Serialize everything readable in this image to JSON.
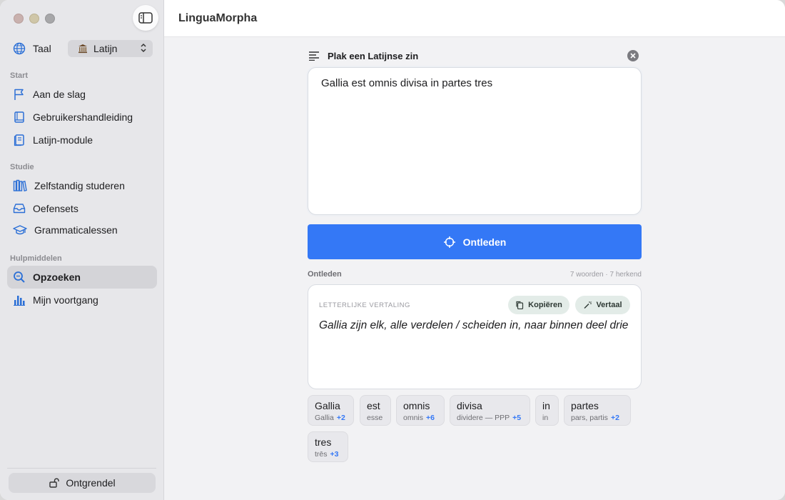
{
  "app": {
    "title": "LinguaMorpha"
  },
  "sidebar": {
    "language": {
      "label": "Taal",
      "selected": "Latijn"
    },
    "sections": [
      {
        "label": "Start",
        "items": [
          {
            "label": "Aan de slag",
            "icon": "flag-icon"
          },
          {
            "label": "Gebruikershandleiding",
            "icon": "book-icon"
          },
          {
            "label": "Latijn-module",
            "icon": "document-icon"
          }
        ]
      },
      {
        "label": "Studie",
        "items": [
          {
            "label": "Zelfstandig studeren",
            "icon": "library-icon"
          },
          {
            "label": "Oefensets",
            "icon": "tray-icon"
          },
          {
            "label": "Grammaticalessen",
            "icon": "graduation-cap-icon"
          }
        ]
      },
      {
        "label": "Hulpmiddelen",
        "items": [
          {
            "label": "Opzoeken",
            "icon": "search-icon",
            "active": true
          },
          {
            "label": "Mijn voortgang",
            "icon": "bar-chart-icon"
          }
        ]
      }
    ],
    "unlock_label": "Ontgrendel"
  },
  "input": {
    "header": "Plak een Latijnse zin",
    "text": "Gallia est omnis divisa in partes tres"
  },
  "parse_button": "Ontleden",
  "result": {
    "title": "Ontleden",
    "stats": "7 woorden · 7 herkend",
    "translation_label": "LETTERLIJKE VERTALING",
    "copy_label": "Kopiëren",
    "translate_label": "Vertaal",
    "translation": "Gallia zijn elk, alle verdelen / scheiden in, naar binnen deel drie"
  },
  "tokens": [
    {
      "word": "Gallia",
      "lemma": "Gallia",
      "more": "+2"
    },
    {
      "word": "est",
      "lemma": "esse",
      "more": ""
    },
    {
      "word": "omnis",
      "lemma": "omnis",
      "more": "+6"
    },
    {
      "word": "divisa",
      "lemma": "dividere — PPP",
      "more": "+5"
    },
    {
      "word": "in",
      "lemma": "in",
      "more": ""
    },
    {
      "word": "partes",
      "lemma": "pars, partis",
      "more": "+2"
    },
    {
      "word": "tres",
      "lemma": "trēs",
      "more": "+3"
    }
  ],
  "colors": {
    "accent": "#3478f6",
    "sidebar_bg": "#e7e7ea",
    "pill_bg": "#e3ece8"
  }
}
